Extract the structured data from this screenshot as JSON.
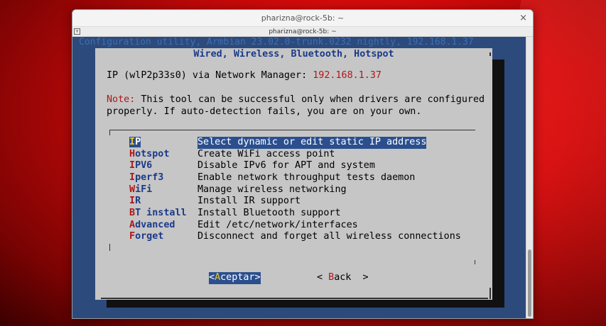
{
  "window": {
    "title": "pharizna@rock-5b: ~",
    "tab_label": "pharizna@rock-5b: ~",
    "close_glyph": "×"
  },
  "terminal": {
    "backtitle": "Configuration utility, Armbian 23.02.0-trunk.0232 nightly, 192.168.1.37",
    "dialog": {
      "title": "Wired, Wireless, Bluetooth, Hotspot",
      "ip_prefix": "IP (wlP2p33s0) via Network Manager: ",
      "ip_address": "192.168.1.37",
      "note_label": "Note:",
      "note_line1": " This tool can be successful only when drivers are configured",
      "note_line2": "properly. If auto-detection fails, you are on your own.",
      "menu": [
        {
          "hot": "I",
          "rest": "P",
          "desc": "Select dynamic or edit static IP address",
          "selected": true
        },
        {
          "hot": "H",
          "rest": "otspot",
          "desc": "Create WiFi access point"
        },
        {
          "hot": "I",
          "rest": "PV6",
          "desc": "Disable IPv6 for APT and system"
        },
        {
          "hot": "I",
          "rest": "perf3",
          "desc": "Enable network throughput tests daemon"
        },
        {
          "hot": "W",
          "rest": "iFi",
          "desc": "Manage wireless networking"
        },
        {
          "hot": "I",
          "rest": "R",
          "desc": "Install IR support"
        },
        {
          "hot": "B",
          "rest": "T install",
          "desc": "Install Bluetooth support"
        },
        {
          "hot": "A",
          "rest": "dvanced",
          "desc": "Edit /etc/network/interfaces"
        },
        {
          "hot": "F",
          "rest": "orget",
          "desc": "Disconnect and forget all wireless connections"
        }
      ],
      "ok_open": "<",
      "ok_hot": "A",
      "ok_rest": "ceptar",
      "ok_close": ">",
      "back_open": "< ",
      "back_hot": "B",
      "back_rest": "ack",
      "back_close": "  >"
    }
  },
  "colors": {
    "terminal_bg": "#2d4a7c",
    "dialog_bg": "#c6c6c6",
    "highlight": "#2b4f8e",
    "hotkey": "#b0161a",
    "title_blue": "#1a3a8a",
    "selected_hotkey": "#e8c32d"
  }
}
